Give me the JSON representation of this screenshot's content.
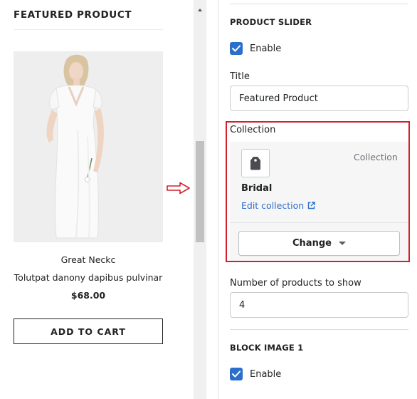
{
  "preview": {
    "section_heading": "FEATURED PRODUCT",
    "product": {
      "name": "Great Neckc",
      "description": "Tolutpat danony dapibus pulvinar",
      "price": "$68.00",
      "add_to_cart_label": "ADD TO CART"
    }
  },
  "settings": {
    "product_slider": {
      "title": "PRODUCT SLIDER",
      "enable_label": "Enable",
      "enable_checked": true
    },
    "title_field": {
      "label": "Title",
      "value": "Featured Product"
    },
    "collection_field": {
      "label": "Collection",
      "type_label": "Collection",
      "name": "Bridal",
      "edit_link_label": "Edit collection",
      "change_button_label": "Change"
    },
    "products_count_field": {
      "label": "Number of products to show",
      "value": "4"
    },
    "block_image_1": {
      "title": "BLOCK IMAGE 1",
      "enable_label": "Enable",
      "enable_checked": true
    }
  },
  "colors": {
    "checkbox_blue": "#2c6ecb",
    "highlight_red": "#d4202a",
    "link_blue": "#2c6ecb"
  },
  "icons": {
    "collection_thumbnail": "tag-icon",
    "edit_link": "external-link-icon",
    "change_dropdown": "caret-down-icon",
    "annotation_arrow": "arrow-right-icon"
  }
}
